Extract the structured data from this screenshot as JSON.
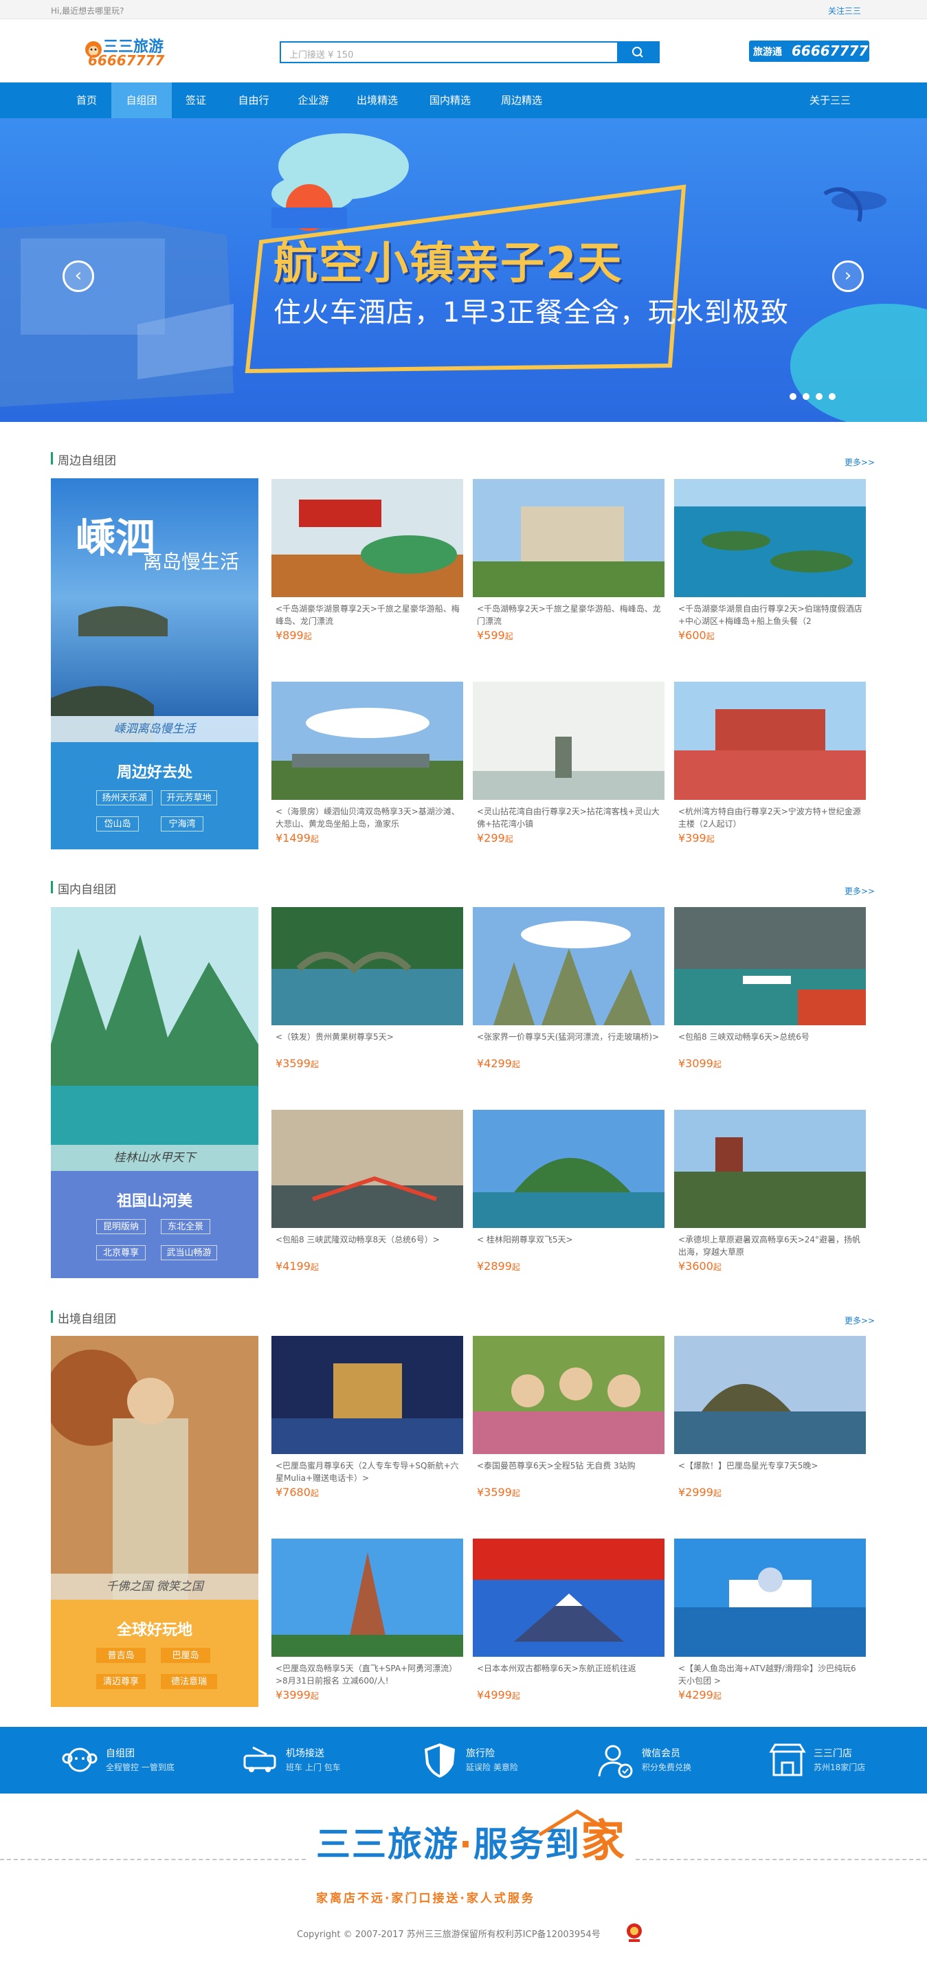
{
  "topbar": {
    "left_text": "Hi,最近想去哪里玩?",
    "right_link": "关注三三"
  },
  "header": {
    "logo_name": "三三旅游",
    "logo_phone": "66667777",
    "search_placeholder": "上门接送 ¥ 150",
    "hotline_label": "旅游通",
    "hotline_number": "66667777"
  },
  "nav": {
    "items": [
      "首页",
      "自组团",
      "签证",
      "自由行",
      "企业游",
      "出境精选",
      "国内精选",
      "周边精选"
    ],
    "active_index": 1,
    "right_link": "关于三三"
  },
  "banner": {
    "title": "航空小镇亲子2天",
    "subtitle": "住火车酒店，1早3正餐全含，玩水到极致",
    "slide_count": 4,
    "active_slide": 1
  },
  "sections": [
    {
      "title": "周边自组团",
      "more": "更多>>",
      "accent": "#2d8fd5",
      "feature": {
        "headline": "嵊泗",
        "headline_sub": "离岛慢生活",
        "caption": "嵊泗离岛慢生活",
        "box_title": "周边好去处",
        "tags": [
          "扬州天乐湖",
          "开元芳草地",
          "岱山岛",
          "宁海湾"
        ]
      },
      "cards": [
        {
          "title": "<千岛湖豪华湖景尊享2天>千旅之星豪华游船、梅峰岛、龙门漂流",
          "price": "¥899",
          "unit": "起"
        },
        {
          "title": "<千岛湖畅享2天>千旅之星豪华游船、梅峰岛、龙门漂流",
          "price": "¥599",
          "unit": "起"
        },
        {
          "title": "<千岛湖豪华湖景自由行尊享2天>伯瑞特度假酒店+中心湖区+梅峰岛+船上鱼头餐（2",
          "price": "¥600",
          "unit": "起"
        },
        {
          "title": "<（海景房）嵊泗仙贝湾双岛畅享3天>基湖沙滩、大悲山、黄龙岛坐船上岛，渔家乐",
          "price": "¥1499",
          "unit": "起"
        },
        {
          "title": "<灵山拈花湾自由行尊享2天>拈花湾客栈+灵山大佛+拈花湾小镇",
          "price": "¥299",
          "unit": "起"
        },
        {
          "title": "<杭州湾方特自由行尊享2天>宁波方特+世纪金源主楼（2人起订）",
          "price": "¥399",
          "unit": "起"
        }
      ]
    },
    {
      "title": "国内自组团",
      "more": "更多>>",
      "accent": "#5f82d4",
      "feature": {
        "headline": "",
        "headline_sub": "",
        "caption": "桂林山水甲天下",
        "box_title": "祖国山河美",
        "tags": [
          "昆明版纳",
          "东北全景",
          "北京尊享",
          "武当山畅游"
        ]
      },
      "cards": [
        {
          "title": "<（铁发）贵州黄果树尊享5天>",
          "price": "¥3599",
          "unit": "起"
        },
        {
          "title": "<张家界一价尊享5天(猛洞河漂流，行走玻璃桥)>",
          "price": "¥4299",
          "unit": "起"
        },
        {
          "title": "<包船8 三峡双动畅享6天>总统6号",
          "price": "¥3099",
          "unit": "起"
        },
        {
          "title": "<包船8 三峡武隆双动畅享8天（总统6号）>",
          "price": "¥4199",
          "unit": "起"
        },
        {
          "title": "< 桂林阳朔尊享双飞5天>",
          "price": "¥2899",
          "unit": "起"
        },
        {
          "title": "<承德坝上草原避暑双高畅享6天>24°避暑，扬帆出海，穿越大草原",
          "price": "¥3600",
          "unit": "起"
        }
      ]
    },
    {
      "title": "出境自组团",
      "more": "更多>>",
      "accent": "#f6b23c",
      "feature": {
        "headline": "",
        "headline_sub": "",
        "caption": "千佛之国 微笑之国",
        "box_title": "全球好玩地",
        "tags": [
          "普吉岛",
          "巴厘岛",
          "清迈尊享",
          "德法意瑞"
        ]
      },
      "cards": [
        {
          "title": "<巴厘岛蜜月尊享6天（2人专车专导+SQ新航+六星Mulia+赠送电话卡）>",
          "price": "¥7680",
          "unit": "起"
        },
        {
          "title": "<泰国曼芭尊享6天>全程5钻 无自费 3站购",
          "price": "¥3599",
          "unit": "起"
        },
        {
          "title": "<【爆款！】巴厘岛星光专享7天5晚>",
          "price": "¥2999",
          "unit": "起"
        },
        {
          "title": "<巴厘岛双岛畅享5天（直飞+SPA+阿勇河漂流）>8月31日前报名 立减600/人!",
          "price": "¥3999",
          "unit": "起"
        },
        {
          "title": "<日本本州双古都畅享6天>东航正班机往返",
          "price": "¥4999",
          "unit": "起"
        },
        {
          "title": "<【美人鱼岛出海+ATV越野/滑翔伞】沙巴纯玩6天小包团 >",
          "price": "¥4299",
          "unit": "起"
        }
      ]
    }
  ],
  "features": [
    {
      "title": "自组团",
      "desc": "全程管控 一管到底",
      "icon": "monkey-icon"
    },
    {
      "title": "机场接送",
      "desc": "班车 上门 包车",
      "icon": "car-icon"
    },
    {
      "title": "旅行险",
      "desc": "延误险 美意险",
      "icon": "shield-icon"
    },
    {
      "title": "微信会员",
      "desc": "积分免费兑换",
      "icon": "member-icon"
    },
    {
      "title": "三三门店",
      "desc": "苏州18家门店",
      "icon": "store-icon"
    }
  ],
  "footer": {
    "slogan_a": "三三旅游",
    "slogan_dot": "·",
    "slogan_b": "服务到",
    "slogan_c": "家",
    "sub": "家离店不远·家门口接送·家人式服务",
    "copyright": "Copyright © 2007-2017 苏州三三旅游保留所有权利苏ICP备12003954号"
  }
}
